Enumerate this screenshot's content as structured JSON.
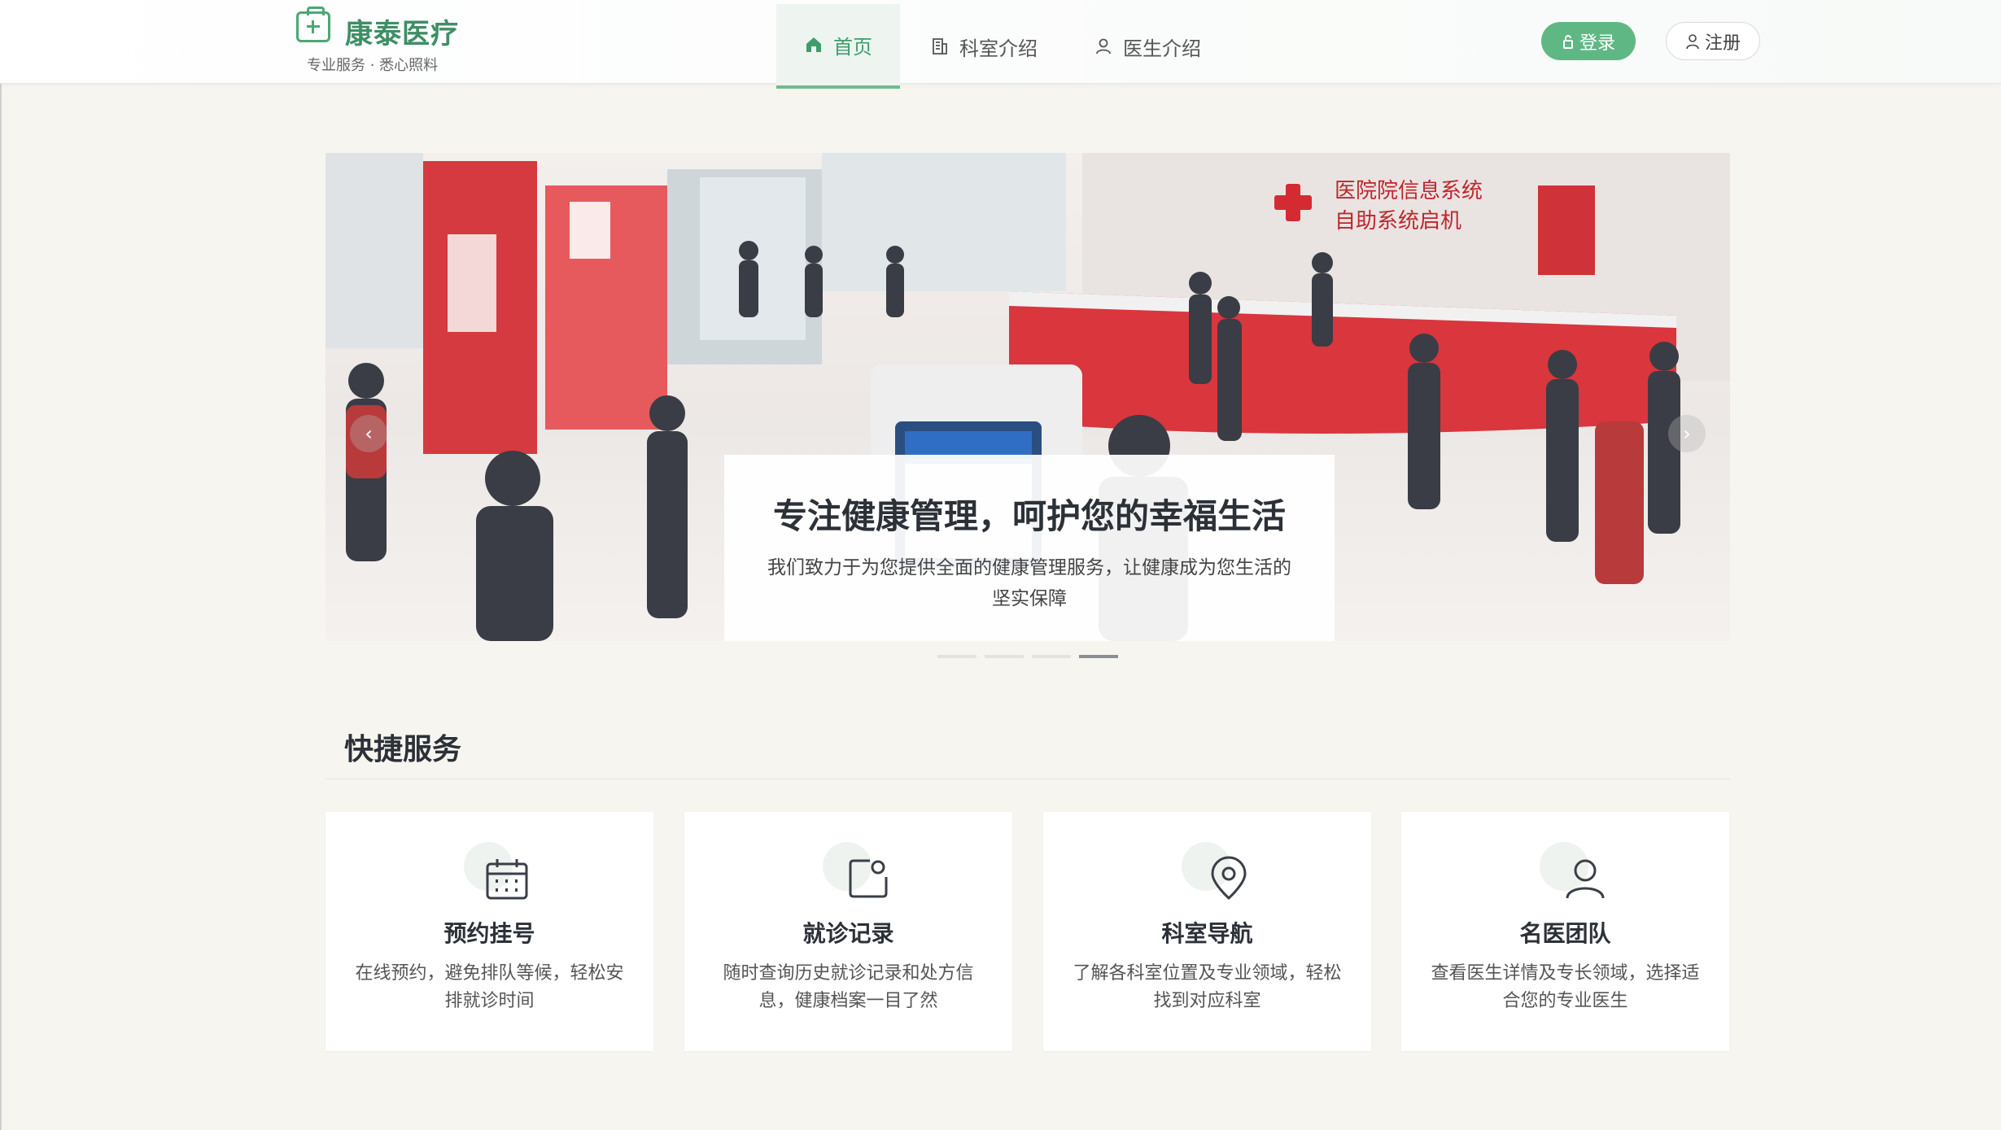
{
  "brand": {
    "name": "康泰医疗",
    "tagline": "专业服务 · 悉心照料",
    "icon": "medical-kit-icon",
    "color": "#4aa876"
  },
  "nav": {
    "items": [
      {
        "label": "首页",
        "icon": "home-icon",
        "active": true
      },
      {
        "label": "科室介绍",
        "icon": "building-icon",
        "active": false
      },
      {
        "label": "医生介绍",
        "icon": "user-icon",
        "active": false
      }
    ]
  },
  "auth": {
    "login_label": "登录",
    "register_label": "注册"
  },
  "banner": {
    "title": "专注健康管理，呵护您的幸福生活",
    "description": "我们致力于为您提供全面的健康管理服务，让健康成为您生活的坚实保障",
    "sign_line1": "医院院信息系统",
    "sign_line2": "自助系统启机",
    "slide_count": 4,
    "active_slide": 4
  },
  "quick_services": {
    "title": "快捷服务",
    "cards": [
      {
        "title": "预约挂号",
        "description": "在线预约，避免排队等候，轻松安排就诊时间",
        "icon": "calendar-icon"
      },
      {
        "title": "就诊记录",
        "description": "随时查询历史就诊记录和处方信息，健康档案一目了然",
        "icon": "record-icon"
      },
      {
        "title": "科室导航",
        "description": "了解各科室位置及专业领域，轻松找到对应科室",
        "icon": "location-pin-icon"
      },
      {
        "title": "名医团队",
        "description": "查看医生详情及专长领域，选择适合您的专业医生",
        "icon": "user-icon"
      }
    ]
  },
  "colors": {
    "accent": "#5fb883",
    "page_bg": "#f6f5f0",
    "banner_red": "#d9363e"
  }
}
